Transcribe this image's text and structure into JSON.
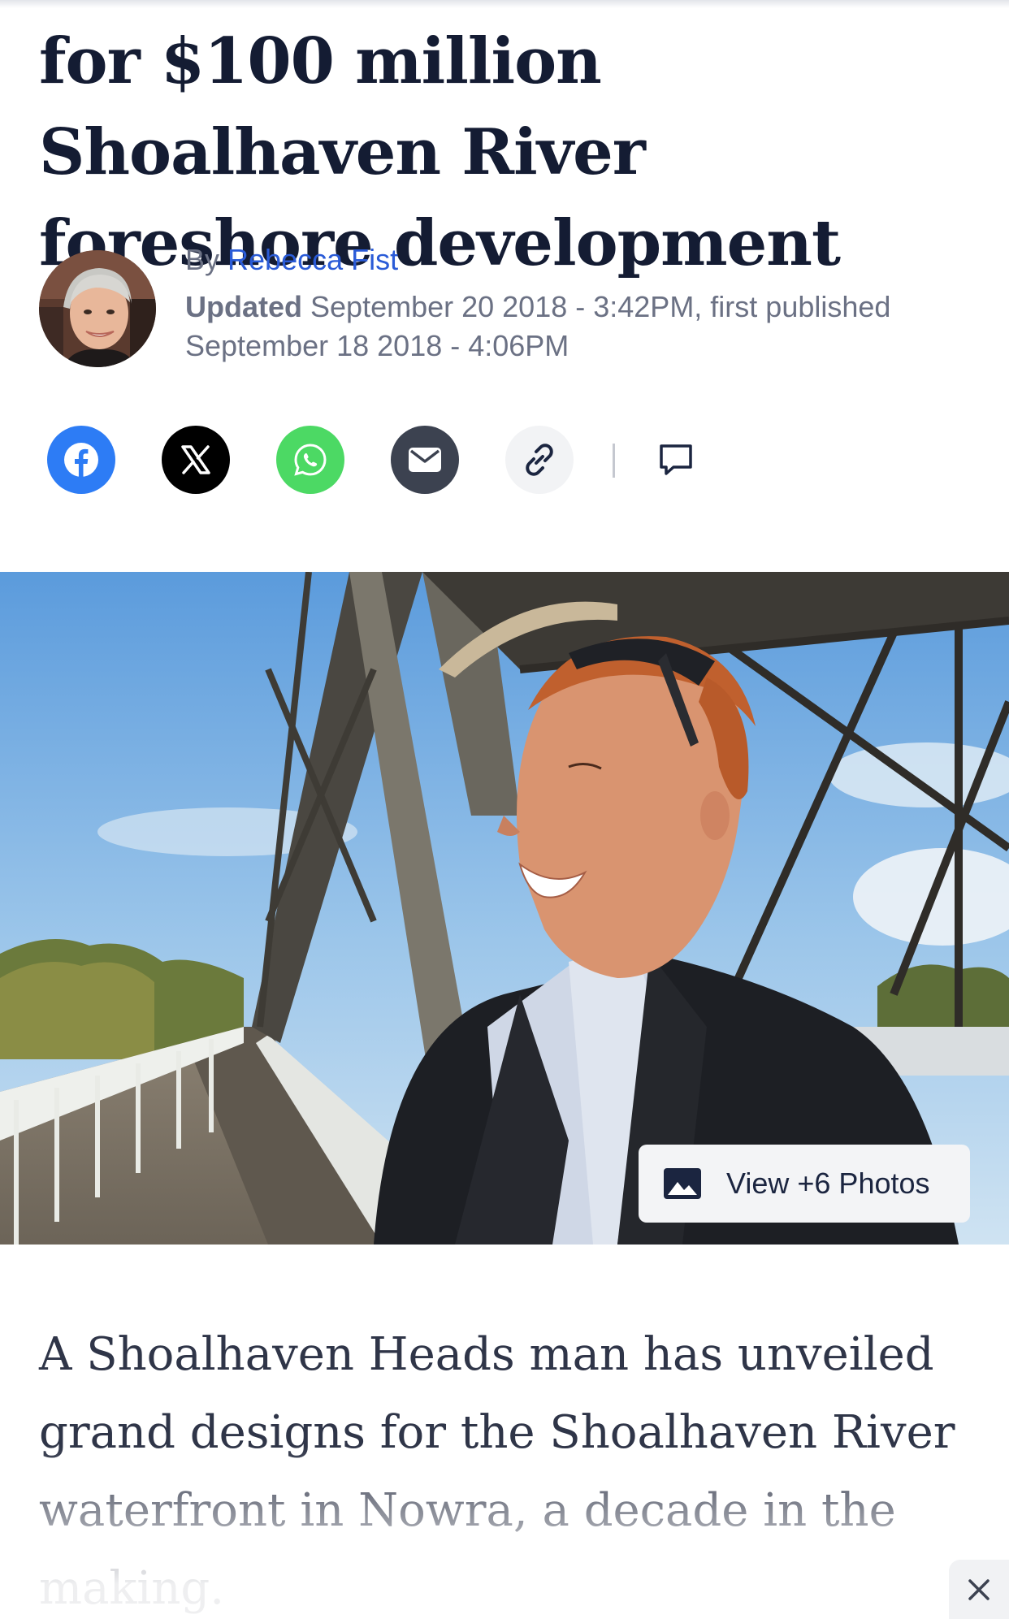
{
  "article": {
    "headline": "for $100 million Shoalhaven River foreshore development",
    "byline": {
      "prefix": "By",
      "author": "Rebecca Fist",
      "updated_label": "Updated",
      "updated_text": "September 20 2018 - 3:42PM, first published September 18 2018 - 4:06PM"
    },
    "lead": "A Shoalhaven Heads man has unveiled grand designs for the Shoalhaven River waterfront in Nowra, a decade in the making."
  },
  "share": {
    "items": [
      {
        "name": "facebook",
        "color": "#2d7cf5",
        "icon": "facebook-icon"
      },
      {
        "name": "x",
        "color": "#000000",
        "icon": "x-icon"
      },
      {
        "name": "whatsapp",
        "color": "#4cd964",
        "icon": "whatsapp-icon"
      },
      {
        "name": "email",
        "color": "#3c4250",
        "icon": "mail-icon"
      },
      {
        "name": "copy-link",
        "color": "#f2f3f5",
        "icon": "link-icon"
      }
    ],
    "comment_icon": "comment-icon"
  },
  "hero": {
    "view_photos_label": "View +6 Photos",
    "photo_icon": "image-icon"
  },
  "overlay": {
    "close_icon": "close-icon"
  },
  "colors": {
    "headline": "#141c33",
    "link": "#2a5bd7",
    "meta": "#6b7184"
  }
}
